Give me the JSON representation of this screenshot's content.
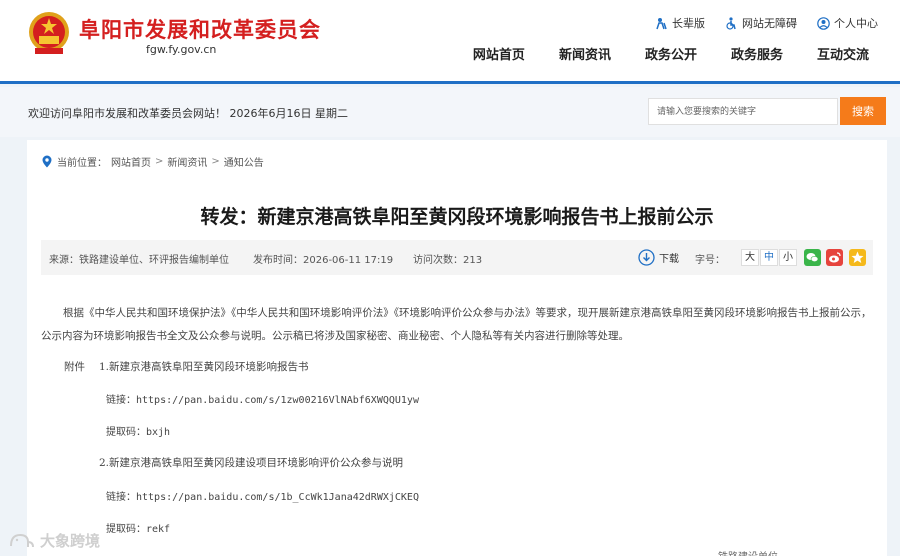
{
  "header": {
    "site_title": "阜阳市发展和改革委员会",
    "site_domain": "fgw.fy.gov.cn",
    "top_links": [
      "长辈版",
      "网站无障碍",
      "个人中心"
    ],
    "nav": [
      "网站首页",
      "新闻资讯",
      "政务公开",
      "政务服务",
      "互动交流"
    ],
    "colors": {
      "brand_red": "#d41f1f",
      "accent_blue": "#1f6fc5",
      "search_orange": "#f57b1a"
    }
  },
  "searchbar": {
    "welcome": "欢迎访问阜阳市发展和改革委员会网站！ 2026年6月16日 星期二",
    "placeholder": "请输入您要搜索的关键字",
    "button": "搜索"
  },
  "breadcrumb": {
    "label": "当前位置：",
    "items": [
      "网站首页",
      "新闻资讯",
      "通知公告"
    ],
    "separator": ">"
  },
  "article": {
    "title": "转发：新建京港高铁阜阳至黄冈段环境影响报告书上报前公示",
    "source": "来源：铁路建设单位、环评报告编制单位",
    "date": "发布时间：2026-06-11 17:19",
    "views": "访问次数：213",
    "download": "下载",
    "font_label": "字号：",
    "font_sizes": [
      "大",
      "中",
      "小"
    ],
    "share_icons": [
      "wechat-icon",
      "weibo-icon",
      "qzone-icon"
    ],
    "paragraph": "根据《中华人民共和国环境保护法》《中华人民共和国环境影响评价法》《环境影响评价公众参与办法》等要求，现开展新建京港高铁阜阳至黄冈段环境影响报告书上报前公示，公示内容为环境影响报告书全文及公众参与说明。公示稿已将涉及国家秘密、商业秘密、个人隐私等有关内容进行删除等处理。",
    "attachment_label": "附件",
    "attachments": [
      {
        "title": "1.新建京港高铁阜阳至黄冈段环境影响报告书",
        "link": "链接：https://pan.baidu.com/s/1zw00216VlNAbf6XWQQU1yw",
        "code": "提取码：bxjh"
      },
      {
        "title": "2.新建京港高铁阜阳至黄冈段建设项目环境影响评价公众参与说明",
        "link": "链接：https://pan.baidu.com/s/1b_CcWk1Jana42dRWXjCKEQ",
        "code": "提取码：rekf"
      }
    ]
  },
  "watermark": "大象跨境",
  "footer_cut": "铁路建设单位"
}
